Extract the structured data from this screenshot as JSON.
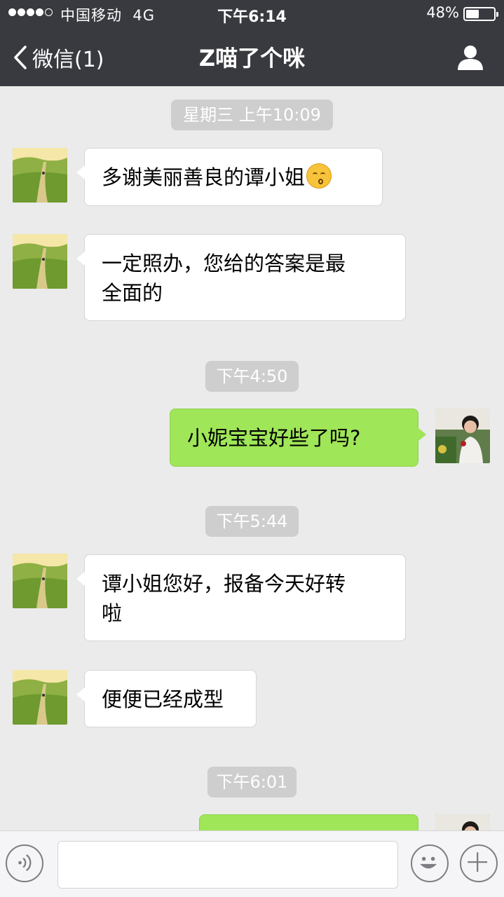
{
  "status_bar": {
    "carrier": "中国移动",
    "network": "4G",
    "time": "下午6:14",
    "battery_percent": "48%",
    "battery_level": 0.48,
    "signal_bars": 4
  },
  "nav": {
    "back_label": "微信(1)",
    "title": "Z喵了个咪"
  },
  "messages": [
    {
      "type": "time",
      "text": "星期三 上午10:09"
    },
    {
      "type": "in",
      "text": "多谢美丽善良的谭小姐",
      "emoji": "kissing-face-icon"
    },
    {
      "type": "in",
      "line1": "一定照办，您给的答案是最",
      "line2": "全面的"
    },
    {
      "type": "time",
      "text": "下午4:50"
    },
    {
      "type": "out",
      "text": "小妮宝宝好些了吗?"
    },
    {
      "type": "time",
      "text": "下午5:44"
    },
    {
      "type": "in",
      "line1": "谭小姐您好，报备今天好转",
      "line2": "啦"
    },
    {
      "type": "in",
      "text": "便便已经成型"
    },
    {
      "type": "time",
      "text": "下午6:01"
    },
    {
      "type": "out",
      "text": ""
    }
  ],
  "input_bar": {
    "placeholder": "",
    "voice_icon": "voice-icon",
    "emoji_icon": "emoji-icon",
    "plus_icon": "plus-icon"
  },
  "colors": {
    "nav_bg": "#393a3f",
    "chat_bg": "#ebebeb",
    "bubble_out": "#9fe658",
    "bubble_in": "#ffffff",
    "time_pill": "#cecece"
  }
}
